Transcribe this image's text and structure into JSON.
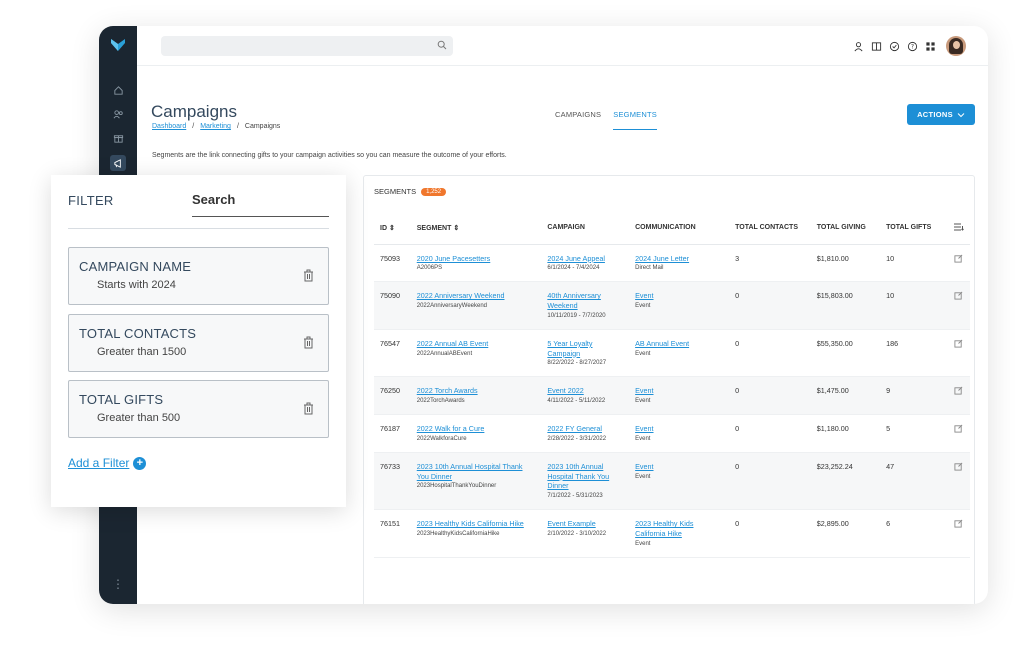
{
  "header": {
    "search_placeholder": "",
    "title": "Campaigns",
    "breadcrumb": [
      "Dashboard",
      "Marketing",
      "Campaigns"
    ],
    "tabs": [
      {
        "label": "CAMPAIGNS"
      },
      {
        "label": "SEGMENTS",
        "active": true
      }
    ],
    "actions_label": "ACTIONS",
    "info": "Segments are the link connecting gifts to your campaign activities so you can measure the outcome of your efforts."
  },
  "segments": {
    "label": "SEGMENTS",
    "count": "1,252",
    "columns": [
      "ID",
      "SEGMENT",
      "CAMPAIGN",
      "COMMUNICATION",
      "TOTAL CONTACTS",
      "TOTAL GIVING",
      "TOTAL GIFTS"
    ],
    "rows": [
      {
        "id": "75093",
        "segment": "2020 June Pacesetters",
        "segment_code": "A2006PS",
        "campaign": "2024 June Appeal",
        "campaign_dates": "6/1/2024 - 7/4/2024",
        "communication": "2024 June Letter",
        "communication_type": "Direct Mail",
        "contacts": "3",
        "giving": "$1,810.00",
        "gifts": "10"
      },
      {
        "id": "75090",
        "segment": "2022 Anniversary Weekend",
        "segment_code": "2022AnniversaryWeekend",
        "campaign": "40th Anniversary Weekend",
        "campaign_dates": "10/11/2019 - 7/7/2020",
        "communication": "Event",
        "communication_type": "Event",
        "contacts": "0",
        "giving": "$15,803.00",
        "gifts": "10"
      },
      {
        "id": "76547",
        "segment": "2022 Annual AB Event",
        "segment_code": "2022AnnualABEvent",
        "campaign": "5 Year Loyalty Campaign",
        "campaign_dates": "8/22/2022 - 8/27/2027",
        "communication": "AB Annual Event",
        "communication_type": "Event",
        "contacts": "0",
        "giving": "$55,350.00",
        "gifts": "186"
      },
      {
        "id": "76250",
        "segment": "2022 Torch Awards",
        "segment_code": "2022TorchAwards",
        "campaign": "Event 2022",
        "campaign_dates": "4/11/2022 - 5/11/2022",
        "communication": "Event",
        "communication_type": "Event",
        "contacts": "0",
        "giving": "$1,475.00",
        "gifts": "9"
      },
      {
        "id": "76187",
        "segment": "2022 Walk for a Cure",
        "segment_code": "2022WalkforaCure",
        "campaign": "2022 FY General",
        "campaign_dates": "2/28/2022 - 3/31/2022",
        "communication": "Event",
        "communication_type": "Event",
        "contacts": "0",
        "giving": "$1,180.00",
        "gifts": "5"
      },
      {
        "id": "76733",
        "segment": "2023 10th Annual Hospital Thank You Dinner",
        "segment_code": "2023HospitalThankYouDinner",
        "campaign": "2023 10th Annual Hospital Thank You Dinner",
        "campaign_dates": "7/1/2022 - 5/31/2023",
        "communication": "Event",
        "communication_type": "Event",
        "contacts": "0",
        "giving": "$23,252.24",
        "gifts": "47"
      },
      {
        "id": "76151",
        "segment": "2023 Healthy Kids California Hike",
        "segment_code": "2023HealthyKidsCaliforniaHike",
        "campaign": "Event Example",
        "campaign_dates": "2/10/2022 - 3/10/2022",
        "communication": "2023 Healthy Kids California Hike",
        "communication_type": "Event",
        "contacts": "0",
        "giving": "$2,895.00",
        "gifts": "6"
      }
    ]
  },
  "filter_panel": {
    "title": "FILTER",
    "search_label": "Search",
    "filters": [
      {
        "name": "CAMPAIGN NAME",
        "value": "Starts with 2024"
      },
      {
        "name": "TOTAL CONTACTS",
        "value": "Greater than 1500"
      },
      {
        "name": "TOTAL GIFTS",
        "value": "Greater than 500"
      }
    ],
    "add_label": "Add a Filter"
  },
  "colors": {
    "accent": "#1d8fd6",
    "badge": "#f0772d",
    "rail": "#1b2631"
  }
}
